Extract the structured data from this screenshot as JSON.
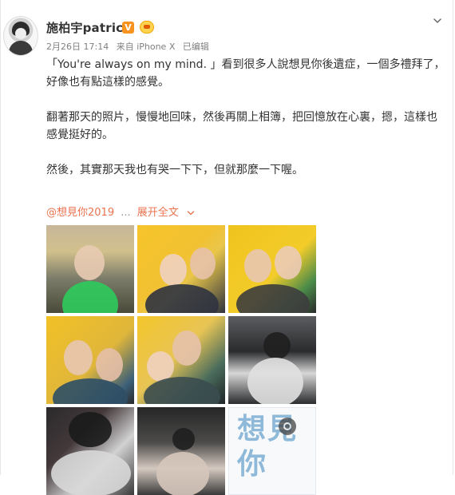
{
  "post": {
    "author_name": "施柏宇patrick",
    "verified_badge": "V",
    "meta": {
      "date": "2月26日 17:14",
      "source": "来自 iPhone X",
      "edited": "已编辑"
    },
    "paragraphs": [
      "「You're always on my mind. 」看到很多人說想見你後遺症，一個多禮拜了，好像也有點這樣的感覺。",
      "翻著那天的照片，慢慢地回味，然後再關上相簿，把回憶放在心裏，摁，這樣也感覺挺好的。",
      "然後，其實那天我也有哭一下下，但就那麼一下喔。"
    ],
    "topic_link": "@想見你2019",
    "ellipsis": "...",
    "expand_label": "展开全文",
    "photos": [
      {
        "name": "photo-1"
      },
      {
        "name": "photo-2"
      },
      {
        "name": "photo-3"
      },
      {
        "name": "photo-4"
      },
      {
        "name": "photo-5"
      },
      {
        "name": "photo-6"
      },
      {
        "name": "photo-7"
      },
      {
        "name": "photo-8"
      },
      {
        "name": "photo-9"
      }
    ],
    "photo9_text": "想見你"
  },
  "colors": {
    "accent_link": "#eb7350",
    "text_main": "#333333",
    "text_meta": "#808080",
    "verified": "#f7931e"
  },
  "icons": {
    "more_menu": "chevron-down-icon",
    "expand": "chevron-down-icon"
  }
}
